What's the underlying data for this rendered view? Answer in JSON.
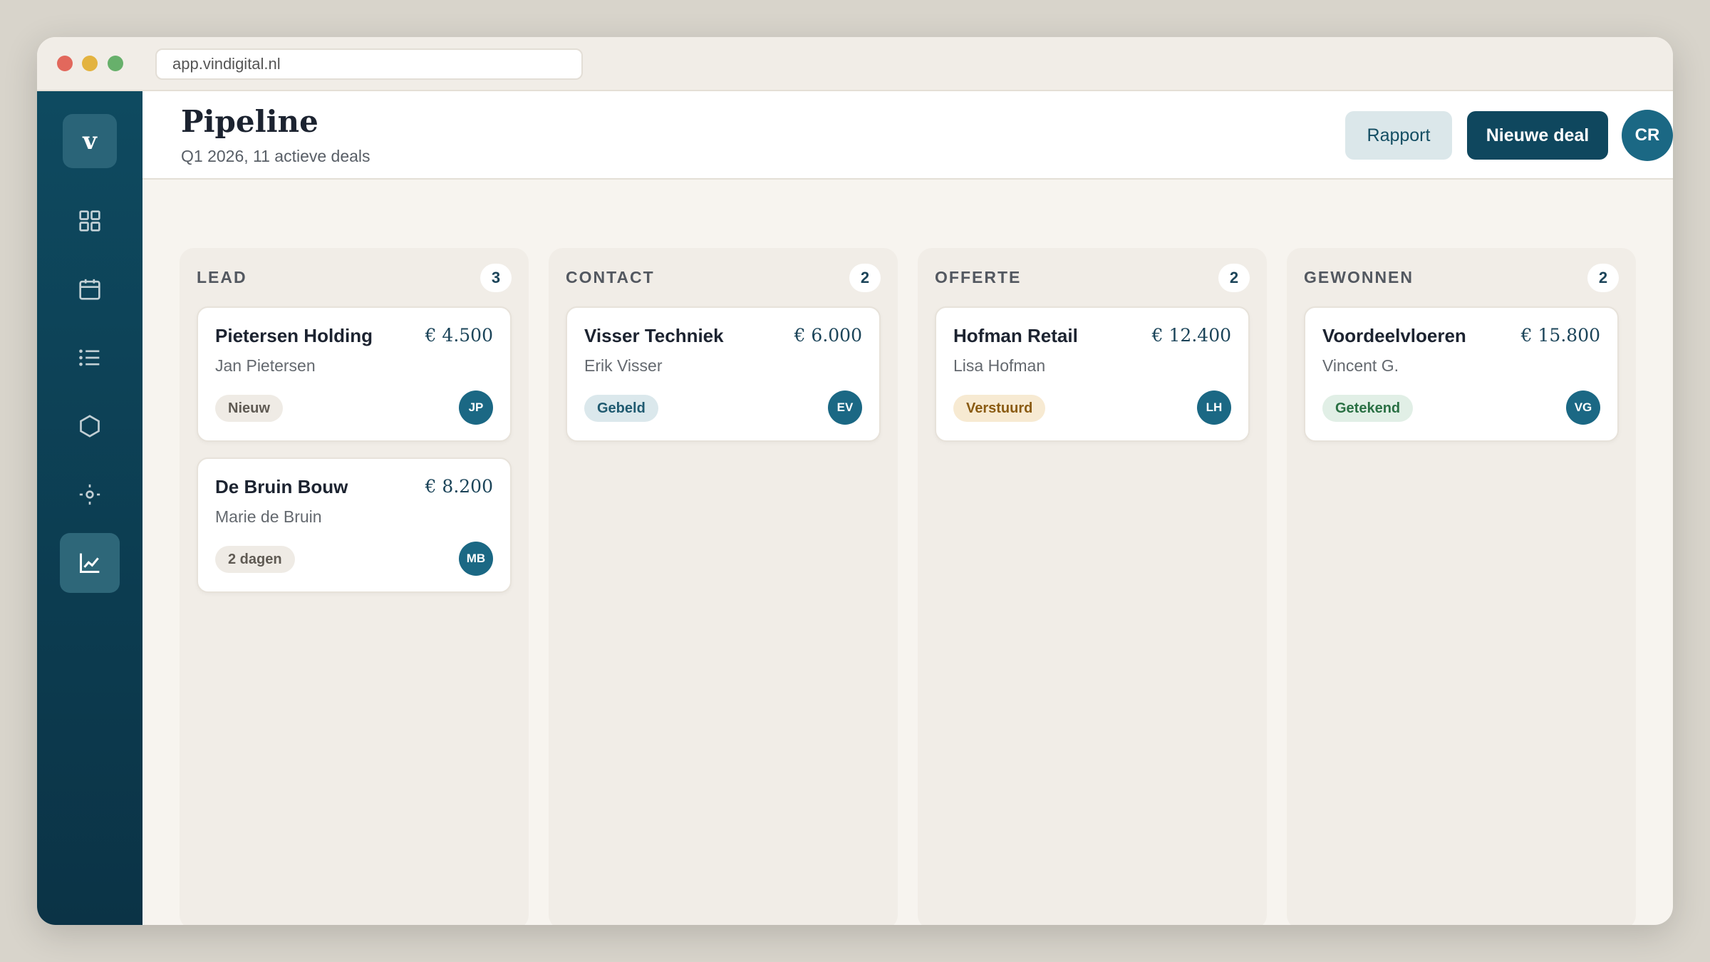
{
  "browser": {
    "url": "app.vindigital.nl"
  },
  "sidebar": {
    "logo": "v",
    "items": [
      {
        "name": "dashboard",
        "icon": "grid-icon"
      },
      {
        "name": "calendar",
        "icon": "calendar-icon"
      },
      {
        "name": "list",
        "icon": "list-icon"
      },
      {
        "name": "products",
        "icon": "hexagon-icon"
      },
      {
        "name": "settings",
        "icon": "crosshair-icon"
      },
      {
        "name": "analytics",
        "icon": "chart-icon",
        "active": true
      }
    ]
  },
  "header": {
    "title": "Pipeline",
    "subtitle": "Q1 2026, 11 actieve deals",
    "report_label": "Rapport",
    "new_deal_label": "Nieuwe deal",
    "user_initials": "CR"
  },
  "columns": [
    {
      "title": "LEAD",
      "count": "3",
      "cards": [
        {
          "name": "Pietersen Holding",
          "value": "€ 4.500",
          "contact": "Jan Pietersen",
          "badge": "Nieuw",
          "badge_bg": "#efebe5",
          "badge_color": "#5f5a53",
          "initials": "JP"
        },
        {
          "name": "De Bruin Bouw",
          "value": "€ 8.200",
          "contact": "Marie de Bruin",
          "badge": "2 dagen",
          "badge_bg": "#efebe5",
          "badge_color": "#5f5a53",
          "initials": "MB"
        }
      ]
    },
    {
      "title": "CONTACT",
      "count": "2",
      "cards": [
        {
          "name": "Visser Techniek",
          "value": "€ 6.000",
          "contact": "Erik Visser",
          "badge": "Gebeld",
          "badge_bg": "#dbe8ec",
          "badge_color": "#1f5a70",
          "initials": "EV"
        }
      ]
    },
    {
      "title": "OFFERTE",
      "count": "2",
      "cards": [
        {
          "name": "Hofman Retail",
          "value": "€ 12.400",
          "contact": "Lisa Hofman",
          "badge": "Verstuurd",
          "badge_bg": "#f7ead2",
          "badge_color": "#8a5b12",
          "initials": "LH"
        }
      ]
    },
    {
      "title": "GEWONNEN",
      "count": "2",
      "cards": [
        {
          "name": "Voordeelvloeren",
          "value": "€ 15.800",
          "contact": "Vincent G.",
          "badge": "Getekend",
          "badge_bg": "#e1efe6",
          "badge_color": "#2a7044",
          "initials": "VG"
        }
      ]
    }
  ]
}
